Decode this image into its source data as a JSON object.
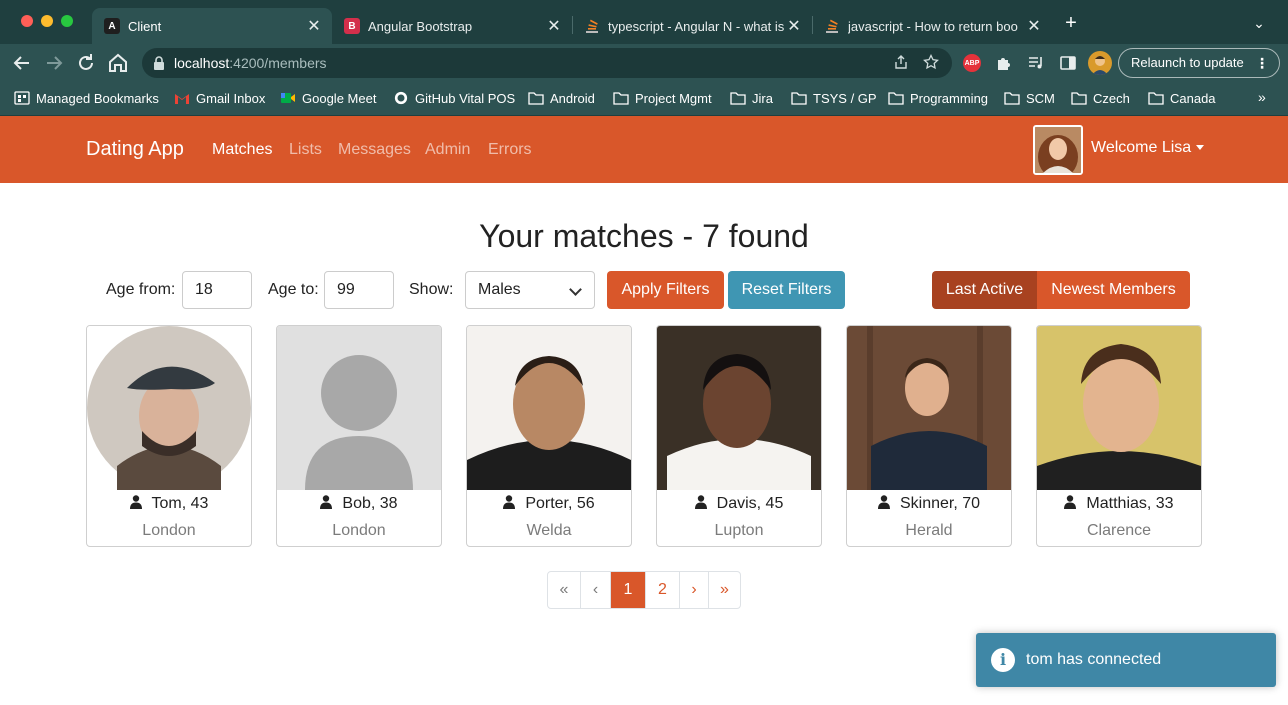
{
  "browser": {
    "tabs": [
      {
        "title": "Client",
        "close": "✕"
      },
      {
        "title": "Angular Bootstrap",
        "close": "✕"
      },
      {
        "title": "typescript - Angular N - what is",
        "close": "✕"
      },
      {
        "title": "javascript - How to return boo",
        "close": "✕"
      }
    ],
    "new_tab": "+",
    "tab_menu": "⌄",
    "url_host": "localhost",
    "url_path": ":4200/members",
    "relaunch_label": "Relaunch to update",
    "abp_label": "ABP",
    "bookmarks": [
      "Managed Bookmarks",
      "Gmail Inbox",
      "Google Meet",
      "GitHub Vital POS",
      "Android",
      "Project Mgmt",
      "Jira",
      "TSYS / GP",
      "Programming",
      "SCM",
      "Czech",
      "Canada"
    ],
    "bookmarks_more": "»"
  },
  "nav": {
    "brand": "Dating App",
    "links": [
      "Matches",
      "Lists",
      "Messages",
      "Admin",
      "Errors"
    ],
    "welcome": "Welcome Lisa"
  },
  "main": {
    "heading": "Your matches - 7 found",
    "filters": {
      "age_from_label": "Age from:",
      "age_from_value": "18",
      "age_to_label": "Age to:",
      "age_to_value": "99",
      "show_label": "Show:",
      "show_value": "Males",
      "apply_label": "Apply Filters",
      "reset_label": "Reset Filters",
      "order_last_active": "Last Active",
      "order_newest": "Newest Members"
    },
    "members": [
      {
        "name": "Tom, 43",
        "city": "London"
      },
      {
        "name": "Bob, 38",
        "city": "London"
      },
      {
        "name": "Porter, 56",
        "city": "Welda"
      },
      {
        "name": "Davis, 45",
        "city": "Lupton"
      },
      {
        "name": "Skinner, 70",
        "city": "Herald"
      },
      {
        "name": "Matthias, 33",
        "city": "Clarence"
      }
    ],
    "pagination": {
      "first": "«",
      "prev": "‹",
      "pages": [
        "1",
        "2"
      ],
      "next": "›",
      "last": "»"
    }
  },
  "toast": {
    "icon": "i",
    "message": "tom has connected"
  },
  "colors": {
    "accent": "#d9572a",
    "info": "#3f96b3",
    "toast": "#3f87a6"
  }
}
